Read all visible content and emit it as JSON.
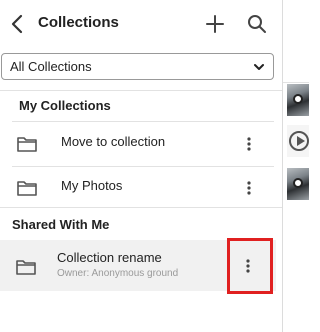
{
  "header": {
    "title": "Collections"
  },
  "filter": {
    "selected": "All Collections"
  },
  "my_collections": {
    "label": "My Collections",
    "items": [
      {
        "name": "Move to collection"
      },
      {
        "name": "My Photos"
      }
    ]
  },
  "shared": {
    "label": "Shared With Me",
    "items": [
      {
        "name": "Collection rename",
        "owner": "Owner: Anonymous ground"
      }
    ]
  },
  "icons": {
    "back": "chevron-left-icon",
    "add": "plus-icon",
    "search": "search-icon",
    "dropdown": "chevron-down-icon",
    "folder": "folder-icon",
    "more": "kebab-menu-icon"
  },
  "colors": {
    "highlight": "#e02020",
    "selected_row": "#f1f1f1"
  }
}
